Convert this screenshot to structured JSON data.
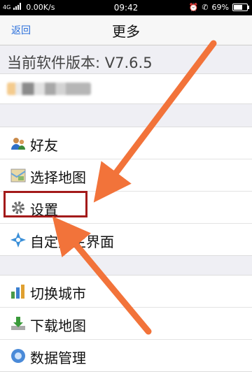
{
  "status": {
    "left_text": "0.00K/s",
    "network": "4G",
    "time": "09:42",
    "battery": "69%"
  },
  "navbar": {
    "back_label": "返回",
    "title": "更多"
  },
  "version_text": "当前软件版本: V7.6.5",
  "menu_group1": [
    {
      "label": "好友",
      "icon": "friends-icon"
    },
    {
      "label": "选择地图",
      "icon": "map-select-icon"
    },
    {
      "label": "设置",
      "icon": "gear-icon"
    },
    {
      "label": "自定义主界面",
      "icon": "customize-icon"
    }
  ],
  "menu_group2": [
    {
      "label": "切换城市",
      "icon": "chart-city-icon"
    },
    {
      "label": "下载地图",
      "icon": "download-icon"
    },
    {
      "label": "数据管理",
      "icon": "data-icon"
    }
  ],
  "colors": {
    "accent": "#2a6fdb",
    "arrow": "#f2733a",
    "highlight": "#a31a1a"
  }
}
